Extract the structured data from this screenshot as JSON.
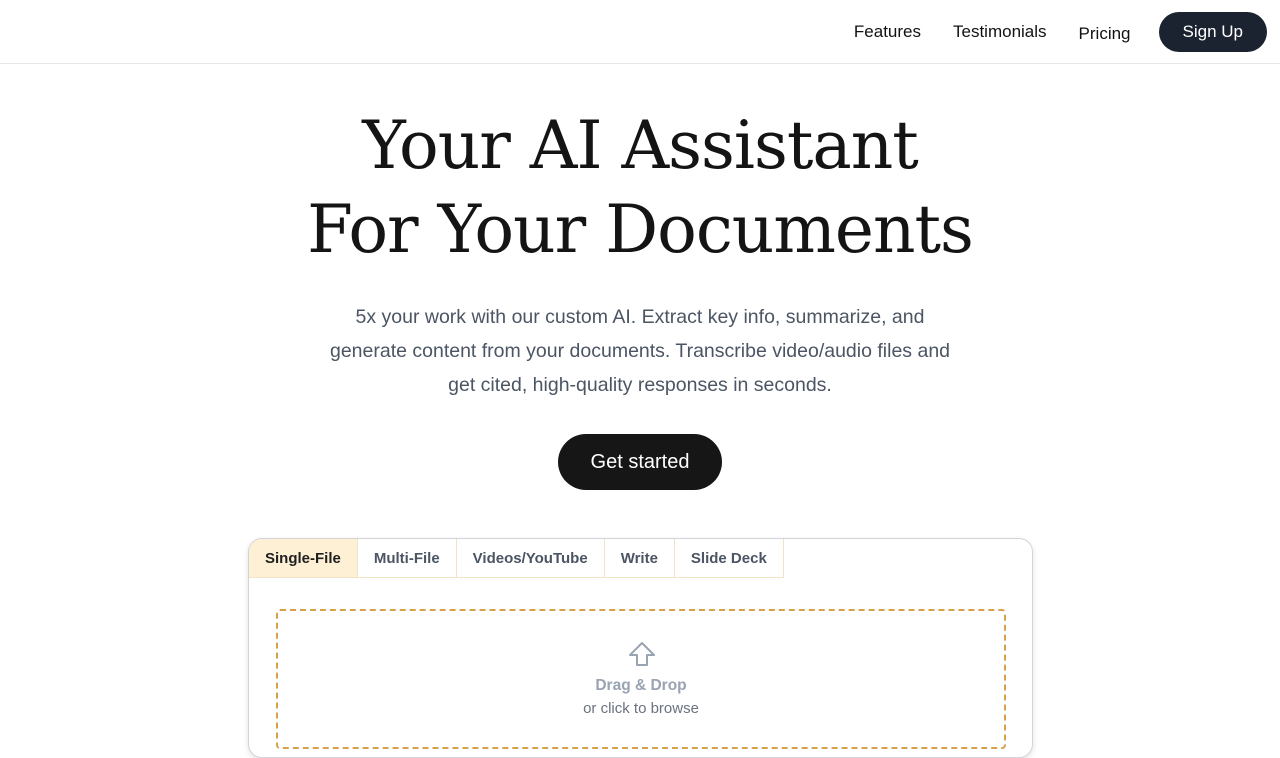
{
  "nav": {
    "links": [
      {
        "label": "Features"
      },
      {
        "label": "Testimonials"
      },
      {
        "label": "Pricing"
      }
    ],
    "signup_label": "Sign Up"
  },
  "hero": {
    "title_line1": "Your AI Assistant",
    "title_line2": "For Your Documents",
    "subtitle": "5x your work with our custom AI. Extract key info, summarize, and generate content from your documents. Transcribe video/audio files and get cited, high-quality responses in seconds.",
    "cta_label": "Get started"
  },
  "uploader": {
    "tabs": [
      {
        "label": "Single-File",
        "active": true
      },
      {
        "label": "Multi-File",
        "active": false
      },
      {
        "label": "Videos/YouTube",
        "active": false
      },
      {
        "label": "Write",
        "active": false
      },
      {
        "label": "Slide Deck",
        "active": false
      }
    ],
    "dropzone": {
      "icon": "upload-arrow-icon",
      "title": "Drag & Drop",
      "subtitle": "or click to browse"
    }
  },
  "colors": {
    "nav_button_bg": "#1b2230",
    "cta_bg": "#161616",
    "active_tab_bg": "#fdf0d5",
    "dropzone_border": "#d9a04a",
    "subtitle_text": "#4b5563"
  }
}
